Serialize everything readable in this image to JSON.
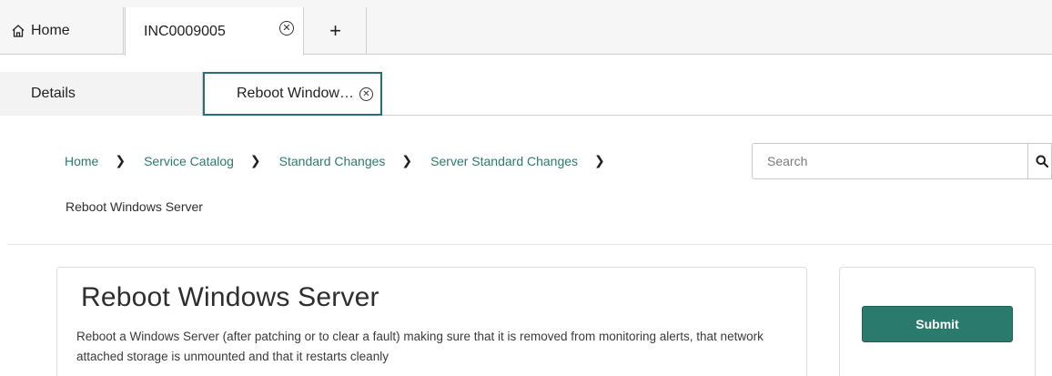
{
  "top_tabs": {
    "home_label": "Home",
    "home_icon": "home-icon",
    "incident_label": "INC0009005",
    "close_icon": "close-circle-icon",
    "add_icon": "plus-icon"
  },
  "sub_tabs": {
    "details_label": "Details",
    "item_label": "Reboot Window…",
    "close_icon": "close-circle-icon"
  },
  "breadcrumb": {
    "items": [
      "Home",
      "Service Catalog",
      "Standard Changes",
      "Server Standard Changes"
    ],
    "current": "Reboot Windows Server",
    "separator_icon": "chevron-right-icon"
  },
  "search": {
    "placeholder": "Search",
    "value": "",
    "icon": "search-icon"
  },
  "item": {
    "title": "Reboot Windows Server",
    "description": "Reboot a Windows Server (after patching or to clear a fault) making sure that it is removed from monitoring alerts, that network attached storage is unmounted and that it restarts cleanly"
  },
  "actions": {
    "submit_label": "Submit"
  },
  "colors": {
    "accent": "#2b7a6e",
    "active_tab_border": "#276f74"
  }
}
